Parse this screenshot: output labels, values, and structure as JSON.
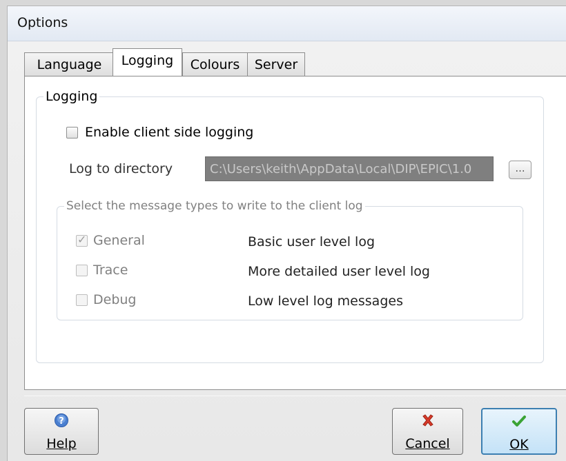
{
  "window": {
    "title": "Options"
  },
  "tabs": [
    {
      "label": "Language",
      "active": false
    },
    {
      "label": "Logging",
      "active": true
    },
    {
      "label": "Colours",
      "active": false
    },
    {
      "label": "Server",
      "active": false
    }
  ],
  "logging": {
    "group_title": "Logging",
    "enable_label": "Enable client side logging",
    "enable_checked": false,
    "dir_label": "Log to directory",
    "dir_value": "C:\\Users\\keith\\AppData\\Local\\DIP\\EPIC\\1.0",
    "browse_label": "...",
    "types": {
      "group_title": "Select the message types to write to the client log",
      "items": [
        {
          "label": "General",
          "description": "Basic user level log",
          "checked": true
        },
        {
          "label": "Trace",
          "description": "More detailed user level log",
          "checked": false
        },
        {
          "label": "Debug",
          "description": "Low level log messages",
          "checked": false
        }
      ]
    }
  },
  "buttons": {
    "help": {
      "label": "Help",
      "icon": "help-icon"
    },
    "cancel": {
      "label": "Cancel",
      "icon": "cancel-x-icon"
    },
    "ok": {
      "label": "OK",
      "icon": "check-icon"
    }
  },
  "colors": {
    "accent": "#3c7fb1",
    "help_icon": "#4a7fd0",
    "cancel_icon": "#d83a2a",
    "ok_icon": "#3aa335"
  }
}
